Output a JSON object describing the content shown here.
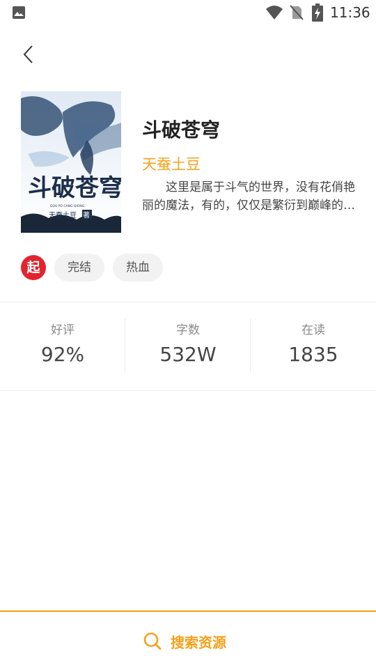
{
  "status_bar": {
    "time": "11:36",
    "icons": [
      "gallery-icon",
      "wifi-icon",
      "no-sim-icon",
      "battery-charging-icon"
    ]
  },
  "header": {
    "back_icon": "chevron-left-icon"
  },
  "book": {
    "title": "斗破苍穹",
    "author": "天蚕土豆",
    "intro": "这里是属于斗气的世界，没有花俏艳丽的魔法，有的，仅仅是繁衍到巅峰的斗气！",
    "cover": {
      "title_text": "斗破苍穹",
      "pinyin_text": "DOU PO CANG QIONG",
      "author_text": "天蚕土豆",
      "seal_text": "著"
    }
  },
  "tags": {
    "source_badge": "起",
    "source_color": "#e2242f",
    "items": [
      "完结",
      "热血"
    ]
  },
  "stats": [
    {
      "label": "好评",
      "value": "92%"
    },
    {
      "label": "字数",
      "value": "532W"
    },
    {
      "label": "在读",
      "value": "1835"
    }
  ],
  "bottom": {
    "search_label": "搜索资源",
    "accent": "#f5a01a"
  }
}
